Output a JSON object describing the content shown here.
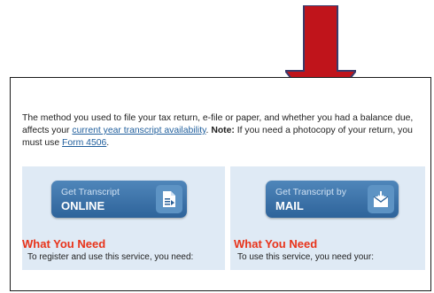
{
  "intro": {
    "text1": "The method you used to file your tax return, e-file or paper, and whether you had a balance due, affects your ",
    "link1": "current year transcript availability",
    "text2": ". ",
    "note_label": "Note:",
    "text3": " If you need a photocopy of your return, you must use ",
    "link2": "Form 4506",
    "text4": "."
  },
  "online": {
    "button_line1": "Get Transcript",
    "button_line2": "ONLINE",
    "icon": "document-icon",
    "heading": "What You Need",
    "description": "To register and use this service, you need:"
  },
  "mail": {
    "button_line1": "Get Transcript by",
    "button_line2": "MAIL",
    "icon": "envelope-icon",
    "heading": "What You Need",
    "description": "To use this service, you need your:"
  },
  "colors": {
    "arrow": "#c0141b",
    "button": "#3a70a6",
    "heading": "#e8331a",
    "panel_bg": "#dfeaf5"
  }
}
